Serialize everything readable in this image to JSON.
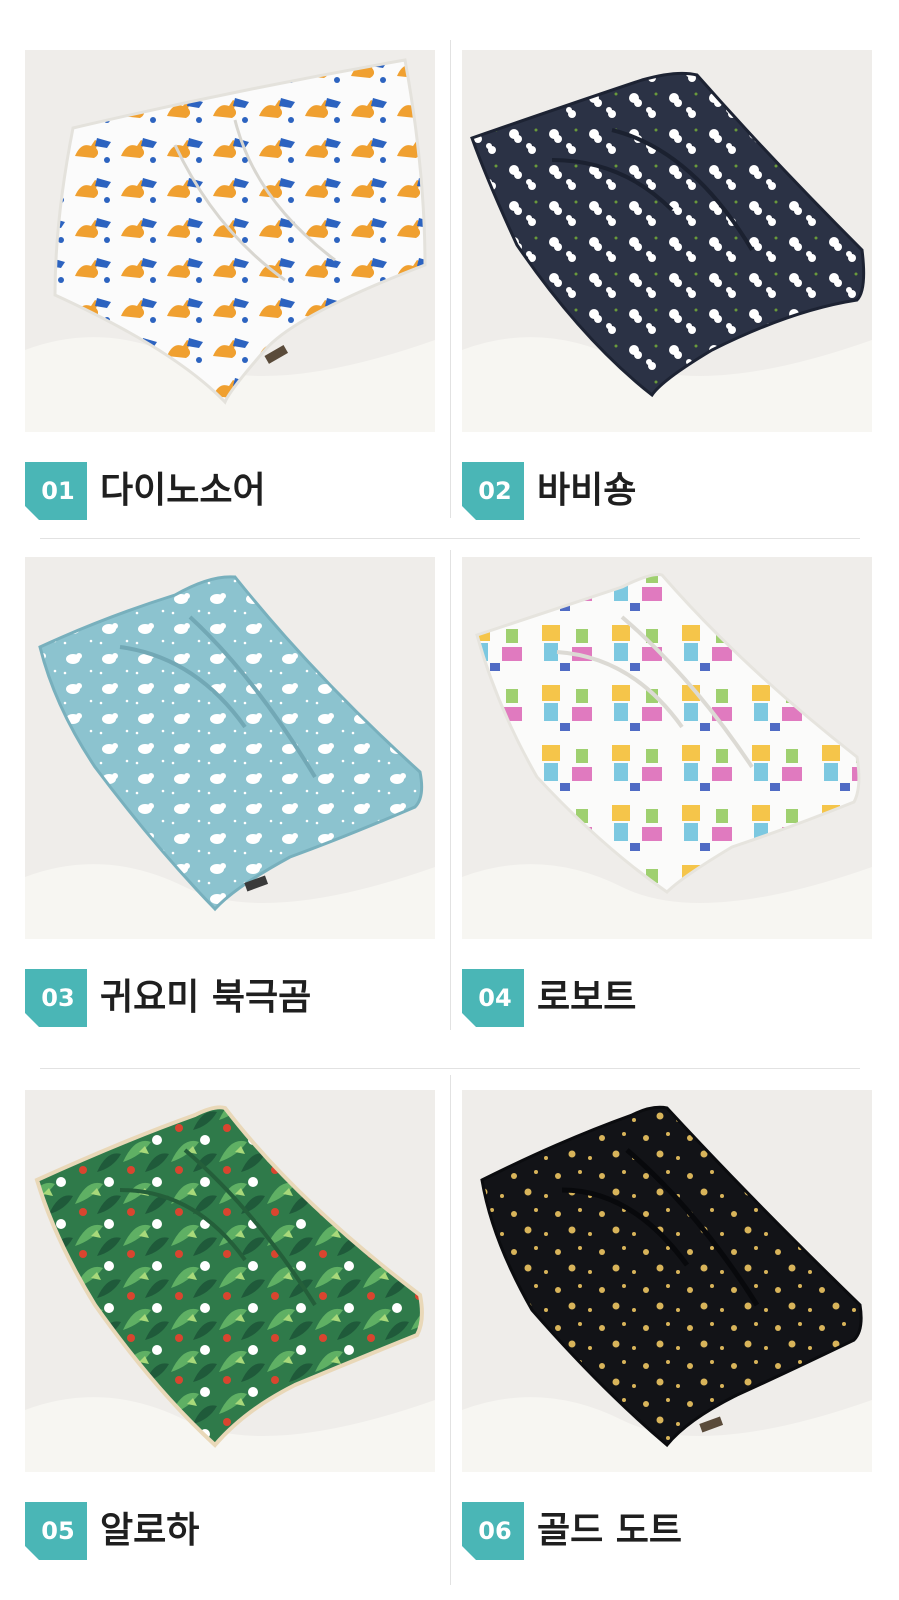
{
  "products": [
    {
      "num": "01",
      "name": "다이노소어",
      "pattern": "dinosaur-print"
    },
    {
      "num": "02",
      "name": "바비숑",
      "pattern": "bichon-dog-print"
    },
    {
      "num": "03",
      "name": "귀요미 북극곰",
      "pattern": "polar-bear-print"
    },
    {
      "num": "04",
      "name": "로보트",
      "pattern": "robot-print"
    },
    {
      "num": "05",
      "name": "알로하",
      "pattern": "tropical-leaf-print"
    },
    {
      "num": "06",
      "name": "골드 도트",
      "pattern": "gold-dot-print"
    }
  ],
  "colors": {
    "badge": "#4ab6b6",
    "text": "#1f1f1f",
    "divider": "#e2e2e2"
  }
}
